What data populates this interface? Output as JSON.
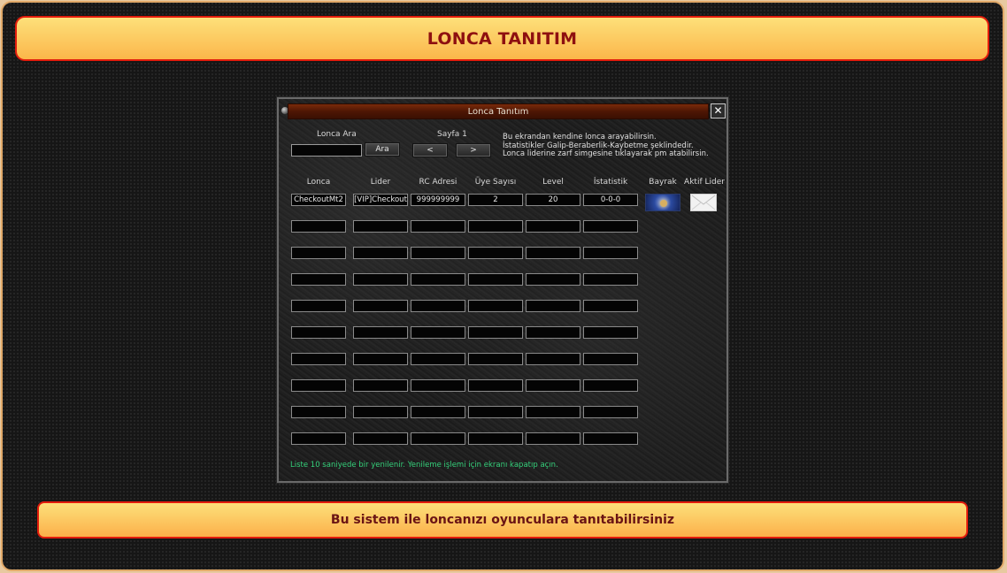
{
  "page": {
    "header_title": "LONCA TANITIM",
    "footer_text": "Bu sistem ile loncanızı oyunculara tanıtabilirsiniz"
  },
  "window": {
    "title": "Lonca Tanıtım",
    "search": {
      "label": "Lonca Ara",
      "value": "",
      "button": "Ara"
    },
    "pager": {
      "label": "Sayfa 1",
      "prev": "<",
      "next": ">"
    },
    "description": [
      "Bu ekrandan kendine lonca arayabilirsin.",
      "İstatistikler Galip-Beraberlik-Kaybetme şeklindedir.",
      "Lonca liderine zarf simgesine tıklayarak pm atabilirsin."
    ],
    "columns": [
      "Lonca",
      "Lider",
      "RC Adresi",
      "Üye Sayısı",
      "Level",
      "İstatistik",
      "Bayrak",
      "Aktif Lider"
    ],
    "rows": [
      [
        "CheckoutMt2",
        "[VIP]Checkout",
        "999999999",
        "2",
        "20",
        "0-0-0"
      ],
      [
        "",
        "",
        "",
        "",
        "",
        ""
      ],
      [
        "",
        "",
        "",
        "",
        "",
        ""
      ],
      [
        "",
        "",
        "",
        "",
        "",
        ""
      ],
      [
        "",
        "",
        "",
        "",
        "",
        ""
      ],
      [
        "",
        "",
        "",
        "",
        "",
        ""
      ],
      [
        "",
        "",
        "",
        "",
        "",
        ""
      ],
      [
        "",
        "",
        "",
        "",
        "",
        ""
      ],
      [
        "",
        "",
        "",
        "",
        "",
        ""
      ],
      [
        "",
        "",
        "",
        "",
        "",
        ""
      ]
    ],
    "first_row_icons": {
      "flag": "guild-flag-icon",
      "mail": "envelope-icon"
    },
    "note": "Liste 10 saniyede bir yenilenir. Yenileme işlemi için ekranı kapatıp açın."
  },
  "colors": {
    "banner_border": "#e21c0c",
    "banner_fill": "#fbc95a",
    "header_text": "#8e1010",
    "note_text": "#34d07a"
  }
}
